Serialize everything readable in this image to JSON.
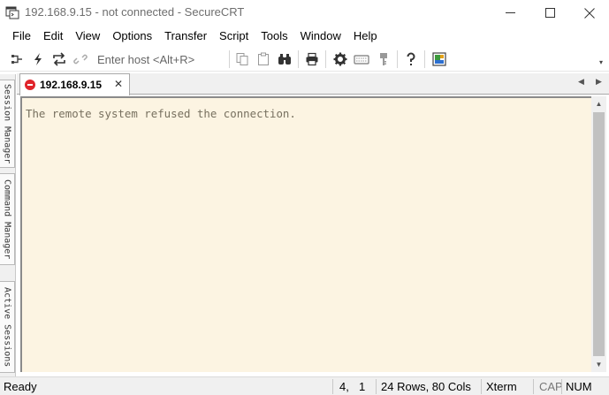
{
  "window": {
    "title": "192.168.9.15 - not connected - SecureCRT",
    "app_icon": "securecrt-icon",
    "controls": [
      "minimize-icon",
      "maximize-icon",
      "close-icon"
    ]
  },
  "menu": {
    "items": [
      "File",
      "Edit",
      "View",
      "Options",
      "Transfer",
      "Script",
      "Tools",
      "Window",
      "Help"
    ]
  },
  "toolbar": {
    "host_placeholder": "Enter host <Alt+R>",
    "buttons": [
      "connect-icon",
      "quick-connect-icon",
      "reconnect-icon",
      "disconnect-icon",
      "copy-icon",
      "paste-icon",
      "find-icon",
      "print-icon",
      "session-options-icon",
      "keymap-editor-icon",
      "sftp-icon",
      "help-icon",
      "screen-icon"
    ]
  },
  "side_tabs": [
    "Session Manager",
    "Command Manager",
    "Active Sessions"
  ],
  "tabs": [
    {
      "label": "192.168.9.15",
      "status_icon": "disconnected-icon",
      "close": "✕"
    }
  ],
  "terminal": {
    "lines": [
      "The remote system refused the connection."
    ],
    "background": "#fcf4e2",
    "text_color": "#77705f"
  },
  "status_bar": {
    "status": "Ready",
    "row": "4,",
    "col": "1",
    "size": "24 Rows, 80 Cols",
    "emulation": "Xterm",
    "cap": "CAP",
    "num": "NUM"
  }
}
